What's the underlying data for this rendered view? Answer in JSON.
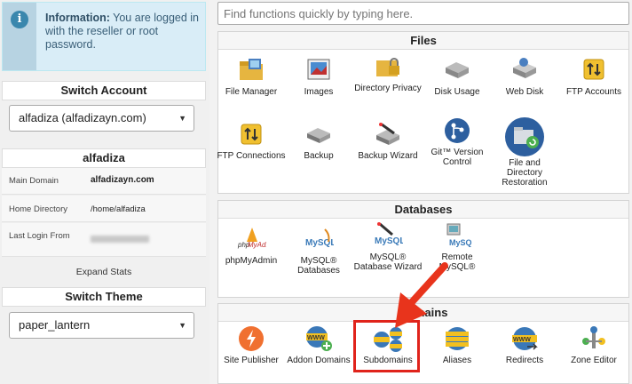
{
  "info": {
    "bold_label": "Information:",
    "message": " You are logged in with the reseller or root password."
  },
  "switch_account": {
    "title": "Switch Account",
    "selected": "alfadiza (alfadizayn.com)"
  },
  "account": {
    "name": "alfadiza",
    "rows": [
      {
        "key": "Main Domain",
        "value": "alfadizayn.com"
      },
      {
        "key": "Home Directory",
        "value": "/home/alfadiza"
      },
      {
        "key": "Last Login From",
        "value": ""
      }
    ],
    "expand_label": "Expand Stats"
  },
  "switch_theme": {
    "title": "Switch Theme",
    "selected": "paper_lantern"
  },
  "search": {
    "placeholder": "Find functions quickly by typing here."
  },
  "groups": {
    "files": {
      "title": "Files",
      "items": [
        {
          "label": "File Manager",
          "icon": "file-manager-icon"
        },
        {
          "label": "Images",
          "icon": "images-icon"
        },
        {
          "label": "Directory Privacy",
          "icon": "directory-privacy-icon"
        },
        {
          "label": "Disk Usage",
          "icon": "disk-usage-icon"
        },
        {
          "label": "Web Disk",
          "icon": "web-disk-icon"
        },
        {
          "label": "FTP Accounts",
          "icon": "ftp-accounts-icon"
        },
        {
          "label": "FTP Connections",
          "icon": "ftp-connections-icon"
        },
        {
          "label": "Backup",
          "icon": "backup-icon"
        },
        {
          "label": "Backup Wizard",
          "icon": "backup-wizard-icon"
        },
        {
          "label": "Git™ Version Control",
          "icon": "git-icon"
        },
        {
          "label": "File and Directory Restoration",
          "icon": "restoration-icon"
        }
      ]
    },
    "databases": {
      "title": "Databases",
      "items": [
        {
          "label": "phpMyAdmin",
          "icon": "phpmyadmin-icon"
        },
        {
          "label": "MySQL® Databases",
          "icon": "mysql-databases-icon"
        },
        {
          "label": "MySQL® Database Wizard",
          "icon": "mysql-wizard-icon"
        },
        {
          "label": "Remote MySQL®",
          "icon": "remote-mysql-icon"
        }
      ]
    },
    "domains": {
      "title": "Domains",
      "items": [
        {
          "label": "Site Publisher",
          "icon": "site-publisher-icon"
        },
        {
          "label": "Addon Domains",
          "icon": "addon-domains-icon"
        },
        {
          "label": "Subdomains",
          "icon": "subdomains-icon"
        },
        {
          "label": "Aliases",
          "icon": "aliases-icon"
        },
        {
          "label": "Redirects",
          "icon": "redirects-icon"
        },
        {
          "label": "Zone Editor",
          "icon": "zone-editor-icon"
        }
      ]
    }
  },
  "colors": {
    "info_bg": "#d9edf7",
    "highlight": "#e0231b",
    "arrow": "#e8341c"
  }
}
